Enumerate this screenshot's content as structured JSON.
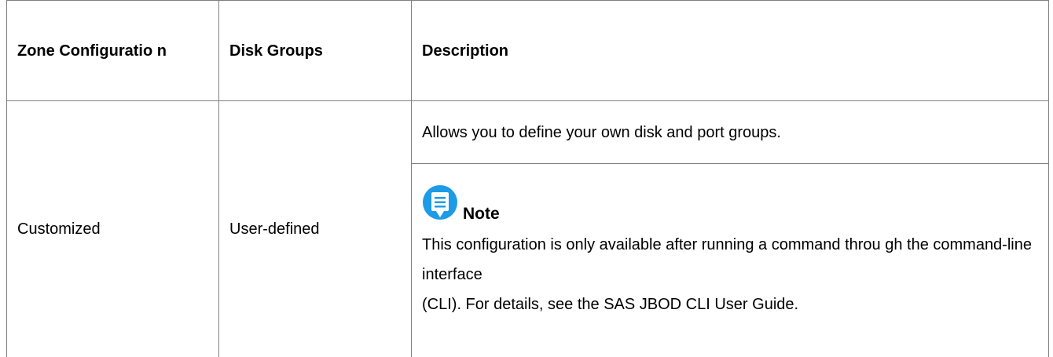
{
  "table": {
    "headers": [
      "Zone Configuratio n",
      "Disk Groups",
      "Description"
    ],
    "row": {
      "zone_configuration": "Customized",
      "disk_groups": "User-defined",
      "description_main": "Allows you to define your own disk and port groups.",
      "note": {
        "icon": "note-icon",
        "label": "Note",
        "line1": "This configuration is only available after running a command throu gh the command-line interface",
        "line2": "(CLI). For details, see the SAS JBOD CLI User Guide."
      }
    }
  },
  "colors": {
    "border": "#7f7f7f",
    "note_icon": "#1e9be6"
  }
}
